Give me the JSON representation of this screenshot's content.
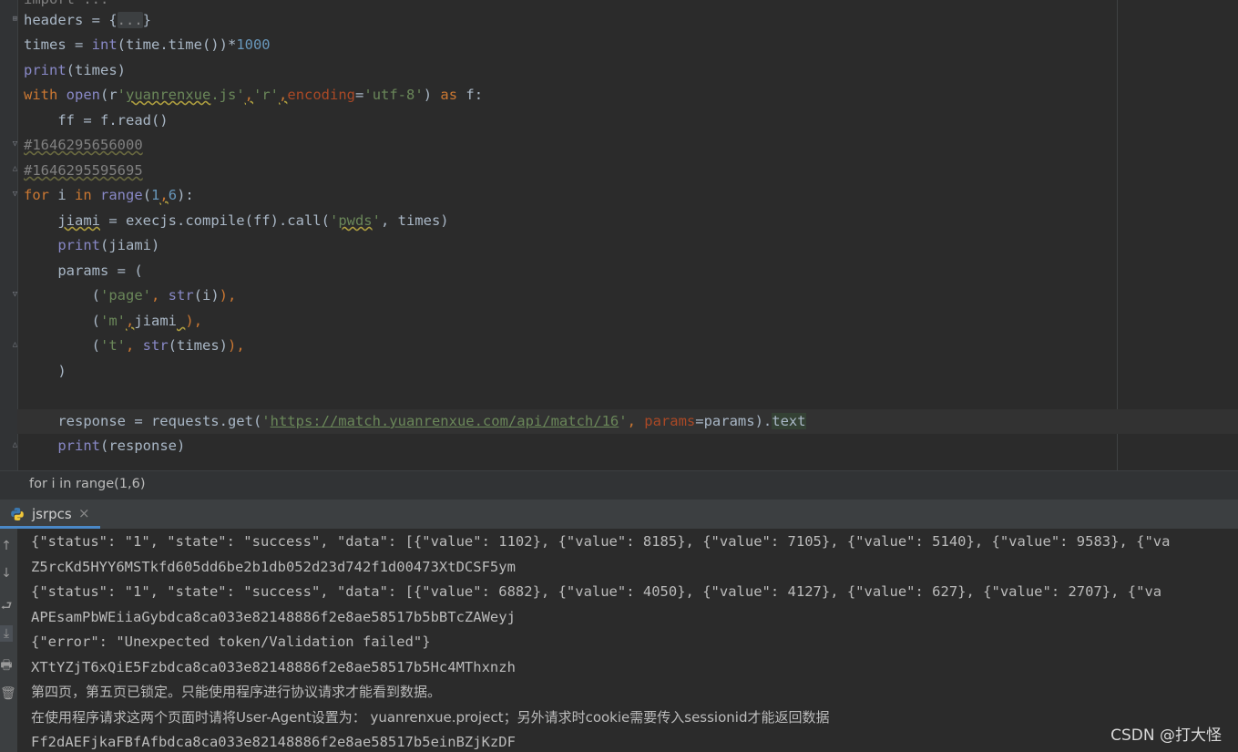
{
  "editor": {
    "lines": [
      [
        "import ..."
      ],
      [
        "headers = {",
        "...",
        "}"
      ],
      [
        "times = ",
        "int",
        "(time.time())*",
        "1000"
      ],
      [
        "print",
        "(times)"
      ],
      [
        "with ",
        "open",
        "(r",
        "'",
        "yuanrenxue",
        ".js'",
        ",",
        "'r'",
        ",",
        "encoding",
        "=",
        "'utf-8'",
        ") ",
        "as",
        " f:"
      ],
      [
        "    ff = f.read()"
      ],
      [
        "#1646295656000"
      ],
      [
        "#1646295595695"
      ],
      [
        "for",
        " i ",
        "in",
        " ",
        "range",
        "(",
        "1",
        ",",
        "6",
        "):"
      ],
      [
        "    ",
        "jiami",
        " = execjs.compile(ff).call(",
        "'",
        "pwds",
        "'",
        ", times)"
      ],
      [
        "    ",
        "print",
        "(jiami)"
      ],
      [
        "    params = ("
      ],
      [
        "        (",
        "'page'",
        ", ",
        "str",
        "(i)",
        "),"
      ],
      [
        "        (",
        "'m'",
        ",",
        "jiami",
        " ",
        "),"
      ],
      [
        "        (",
        "'t'",
        ", ",
        "str",
        "(times)",
        "),"
      ],
      [
        "    )"
      ],
      [
        ""
      ],
      [
        "    response = requests.get(",
        "'",
        "https://match.yuanrenxue.com/api/match/16",
        "'",
        ", ",
        "params",
        "=params).",
        "text"
      ],
      [
        "    ",
        "print",
        "(response)"
      ]
    ]
  },
  "breadcrumb": {
    "text": "for i in range(1,6)"
  },
  "run_tab": {
    "label": "jsrpcs",
    "close": "×"
  },
  "run_tools": [
    "↑",
    "↓",
    "⮐",
    "⤓",
    "🖶",
    "🗑"
  ],
  "console": {
    "lines": [
      "{\"status\": \"1\", \"state\": \"success\", \"data\": [{\"value\": 1102}, {\"value\": 8185}, {\"value\": 7105}, {\"value\": 5140}, {\"value\": 9583}, {\"va",
      "Z5rcKd5HYY6MSTkfd605dd6be2b1db052d23d742f1d00473XtDCSF5ym",
      "{\"status\": \"1\", \"state\": \"success\", \"data\": [{\"value\": 6882}, {\"value\": 4050}, {\"value\": 4127}, {\"value\": 627}, {\"value\": 2707}, {\"va",
      "APEsamPbWEiiaGybdca8ca033e82148886f2e8ae58517b5bBTcZAWeyj",
      "{\"error\": \"Unexpected token/Validation failed\"}",
      "XTtYZjT6xQiE5Fzbdca8ca033e82148886f2e8ae58517b5Hc4MThxnzh",
      "第四页，第五页已锁定。只能使用程序进行协议请求才能看到数据。",
      "在使用程序请求这两个页面时请将User-Agent设置为： yuanrenxue.project；另外请求时cookie需要传入sessionid才能返回数据",
      "Ff2dAEFjkaFBfAfbdca8ca033e82148886f2e8ae58517b5einBZjKzDF"
    ]
  },
  "watermark": "CSDN @打大怪",
  "colors": {
    "background": "#2b2b2b",
    "keyword": "#cc7832",
    "string": "#6a8759",
    "number": "#6897bb",
    "builtin": "#8888c6",
    "tab_underline": "#4a88c7"
  }
}
